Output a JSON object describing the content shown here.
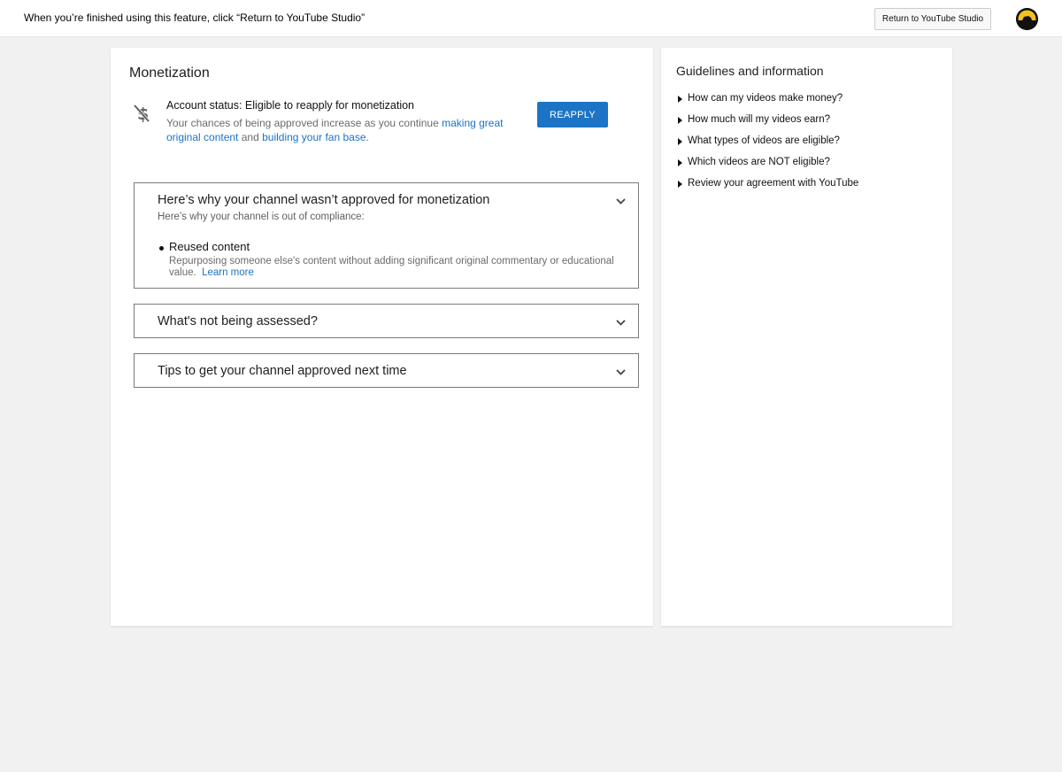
{
  "topbar": {
    "message": "When you’re finished using this feature, click “Return to YouTube Studio”",
    "return_button": "Return to YouTube Studio",
    "avatar_icon": "channel-avatar-icon"
  },
  "monetization": {
    "title": "Monetization",
    "status_icon": "monetization-off-icon",
    "status_title": "Account status: Eligible to reapply for monetization",
    "status_desc_prefix": "Your chances of being approved increase as you continue ",
    "status_link_1": "making great original content",
    "status_desc_mid": " and ",
    "status_link_2": "building your fan base",
    "status_desc_suffix": ".",
    "reapply_button": "REAPPLY",
    "accent_color": "#1b74c5"
  },
  "panels": {
    "not_approved": {
      "title": "Here’s why your channel wasn’t approved for monetization",
      "subtitle": "Here’s why your channel is out of compliance:",
      "reason_title": "Reused content",
      "reason_desc": "Repurposing someone else's content without adding significant original commentary or educational value.",
      "learn_more": "Learn more"
    },
    "not_assessed": {
      "title": "What's not being assessed?"
    },
    "tips": {
      "title": "Tips to get your channel approved next time"
    }
  },
  "guidelines": {
    "title": "Guidelines and information",
    "items": [
      "How can my videos make money?",
      "How much will my videos earn?",
      "What types of videos are eligible?",
      "Which videos are NOT eligible?",
      "Review your agreement with YouTube"
    ]
  }
}
